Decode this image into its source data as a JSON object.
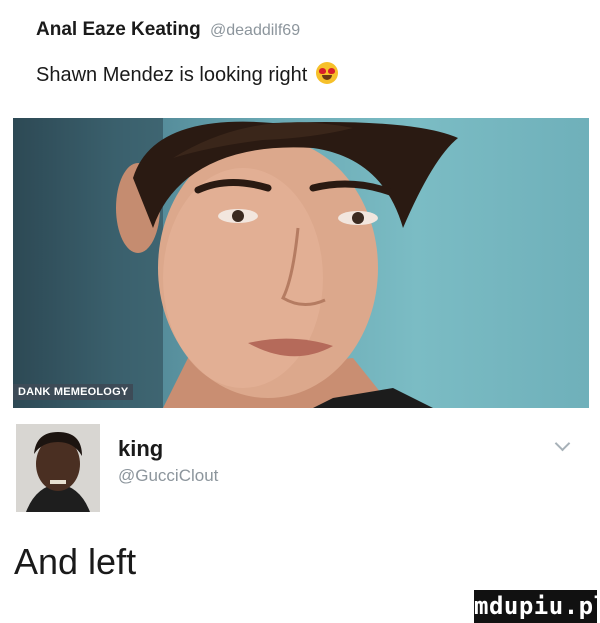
{
  "tweet1": {
    "author_name": "Anal Eaze Keating",
    "author_handle": "@deaddilf69",
    "text": "Shawn Mendez is looking right",
    "emoji": "heart-eyes-emoji"
  },
  "photo": {
    "watermark": "DANK MEMEOLOGY"
  },
  "tweet2": {
    "author_name": "king",
    "author_handle": "@GucciClout",
    "text": "And left",
    "menu_icon": "chevron-down-icon"
  },
  "site_watermark": "mdupiu.pl"
}
